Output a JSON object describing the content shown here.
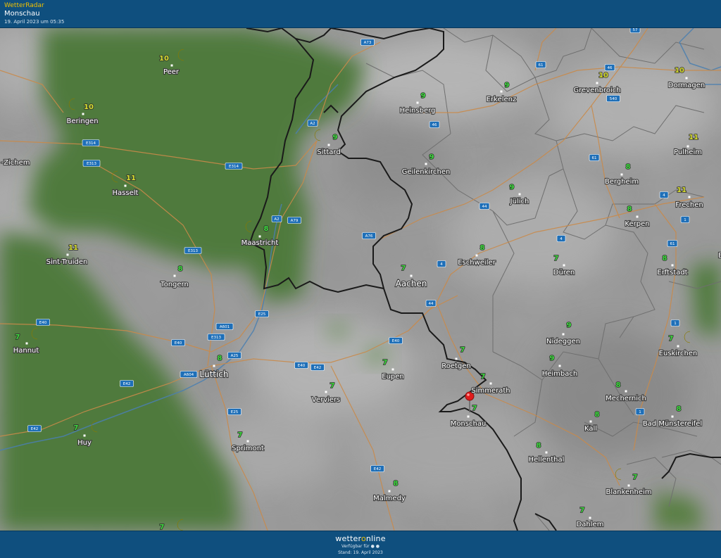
{
  "header": {
    "app_name": "WetterRadar",
    "location": "Monschau",
    "timestamp": "19. April 2023 um 05:35"
  },
  "footer": {
    "logo_part1": "wetter",
    "logo_part2": "o",
    "logo_part3": "nline",
    "available_label": "Verfügbar für",
    "stand": "Stand: 19. April 2023"
  },
  "colors": {
    "header_bg": "#0f4f7e",
    "app_name": "#f2c100",
    "terrain_green": "#4f7a3d",
    "cloud_gray": "#9c9c9c",
    "border": "#1a1a1a",
    "road": "#c98a4a",
    "road_badge": "#1e6fb8",
    "temp_green": "#3ddc3d",
    "temp_yellow": "#d9e030",
    "pin": "#e01c1c"
  },
  "map": {
    "cities": [
      {
        "name": "Peer",
        "temp": "10",
        "moon": true
      },
      {
        "name": "Beringen",
        "temp": "10",
        "moon": true
      },
      {
        "name": "Hasselt",
        "temp": "11",
        "moon": true
      },
      {
        "name": "-Zichem",
        "temp": ""
      },
      {
        "name": "Sint-Truiden",
        "temp": "11"
      },
      {
        "name": "Tongern",
        "temp": "8"
      },
      {
        "name": "Hannut",
        "temp": "7",
        "moon": true
      },
      {
        "name": "Huy",
        "temp": "7",
        "moon": true
      },
      {
        "name": "Maastricht",
        "temp": "8",
        "moon": true
      },
      {
        "name": "Sittard",
        "temp": "9",
        "moon": true
      },
      {
        "name": "Lüttich",
        "temp": "8"
      },
      {
        "name": "Sprimont",
        "temp": "7"
      },
      {
        "name": "Verviers",
        "temp": "7"
      },
      {
        "name": "Eupen",
        "temp": "7"
      },
      {
        "name": "Aachen",
        "temp": "7"
      },
      {
        "name": "Heinsberg",
        "temp": "9"
      },
      {
        "name": "Erkelenz",
        "temp": "9"
      },
      {
        "name": "Geilenkirchen",
        "temp": "9"
      },
      {
        "name": "Jülich",
        "temp": "9"
      },
      {
        "name": "Eschweiler",
        "temp": "8"
      },
      {
        "name": "Düren",
        "temp": "7"
      },
      {
        "name": "Roetgen",
        "temp": "7"
      },
      {
        "name": "Simmerath",
        "temp": "7"
      },
      {
        "name": "Monschau",
        "temp": "7"
      },
      {
        "name": "Nideggen",
        "temp": "9"
      },
      {
        "name": "Heimbach",
        "temp": "9"
      },
      {
        "name": "Grevenbroich",
        "temp": "10"
      },
      {
        "name": "Dormagen",
        "temp": "10"
      },
      {
        "name": "Pulheim",
        "temp": "11"
      },
      {
        "name": "Bergheim",
        "temp": "8"
      },
      {
        "name": "Frechen",
        "temp": "11"
      },
      {
        "name": "Kerpen",
        "temp": "8"
      },
      {
        "name": "Erftstadt",
        "temp": "8"
      },
      {
        "name": "Euskirchen",
        "temp": "7",
        "moon": true
      },
      {
        "name": "Mechernich",
        "temp": "8"
      },
      {
        "name": "Kall",
        "temp": "8"
      },
      {
        "name": "Bad Münstereifel",
        "temp": "8"
      },
      {
        "name": "Hellenthal",
        "temp": "8"
      },
      {
        "name": "Blankenheim",
        "temp": "7",
        "moon": true
      },
      {
        "name": "Malmedy",
        "temp": "8"
      },
      {
        "name": "Dahlem",
        "temp": "7"
      },
      {
        "name": "",
        "temp": "7",
        "moon": true
      },
      {
        "name": "Br",
        "temp": ""
      }
    ],
    "roads": [
      "A73",
      "57",
      "61",
      "46",
      "540",
      "A2",
      "46",
      "E314",
      "E313",
      "E314",
      "61",
      "44",
      "4",
      "A2",
      "A79",
      "A76",
      "4",
      "1",
      "4",
      "61",
      "E313",
      "E40",
      "E25",
      "A601",
      "E313",
      "E40",
      "A25",
      "44",
      "E40",
      "E40",
      "E42",
      "A604",
      "E42",
      "E25",
      "E42",
      "E42",
      "1",
      "1"
    ]
  }
}
